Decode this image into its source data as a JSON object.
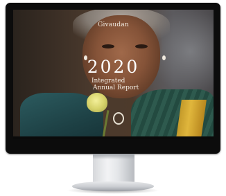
{
  "screen": {
    "brand": "Givaudan",
    "year": "2020",
    "subtitle_line1": "Integrated",
    "subtitle_line2": "Annual Report"
  },
  "device": {
    "type": "desktop-monitor",
    "bezel_color": "#0c0c0c",
    "stand_color": "#e4e6e9"
  },
  "photo": {
    "subject": "woman-holding-flower",
    "accent_colors": [
      "#2c5b5f",
      "#e0b63c",
      "#d7d36b",
      "#855338"
    ]
  }
}
